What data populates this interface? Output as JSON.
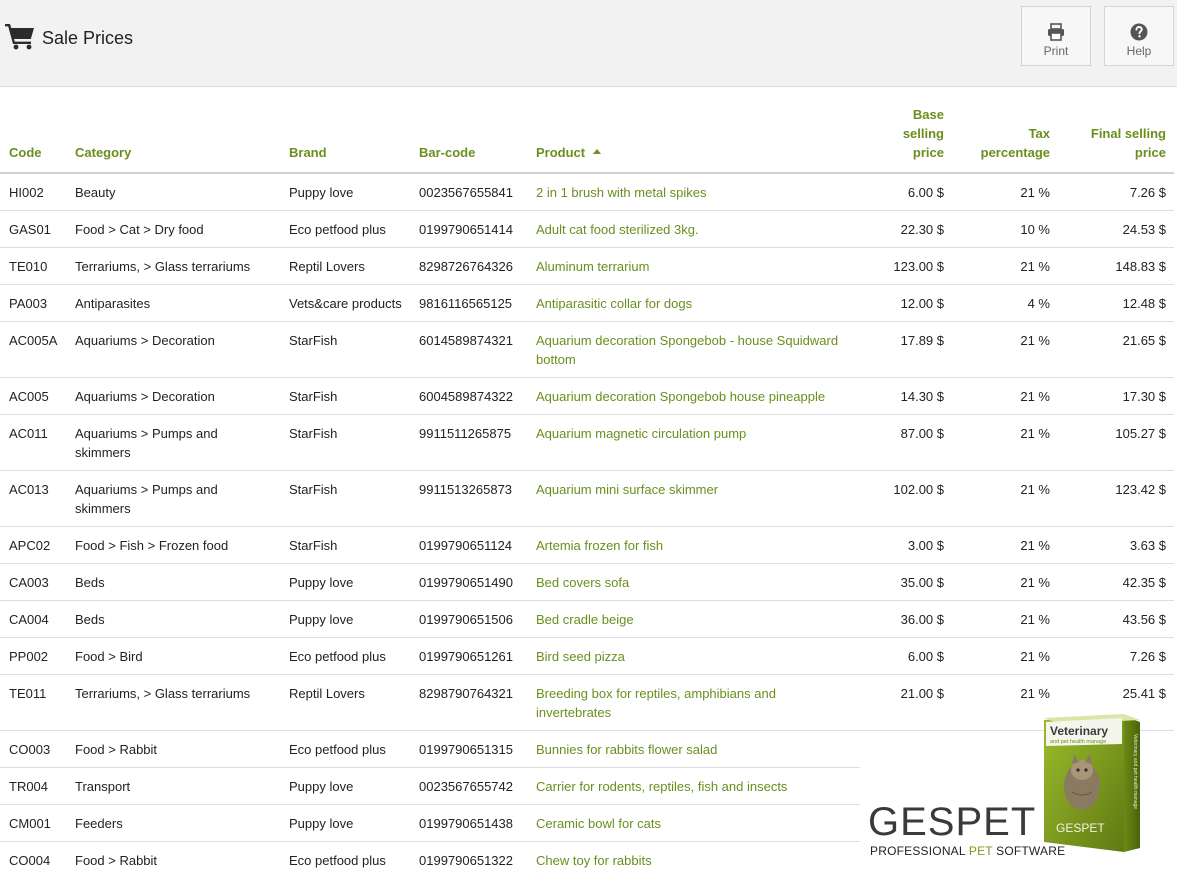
{
  "header": {
    "title": "Sale Prices",
    "print_label": "Print",
    "help_label": "Help"
  },
  "table": {
    "columns": {
      "code": "Code",
      "category": "Category",
      "brand": "Brand",
      "barcode": "Bar-code",
      "product": "Product",
      "base_line1": "Base selling",
      "base_line2": "price",
      "tax_line1": "Tax",
      "tax_line2": "percentage",
      "final_line1": "Final selling",
      "final_line2": "price"
    },
    "sort": {
      "column": "Product",
      "direction": "ascending"
    },
    "rows": [
      {
        "code": "HI002",
        "category": "Beauty",
        "brand": "Puppy love",
        "barcode": "0023567655841",
        "product": "2 in 1 brush with metal spikes",
        "base": "6.00 $",
        "tax": "21 %",
        "final": "7.26 $"
      },
      {
        "code": "GAS01",
        "category": "Food > Cat > Dry food",
        "brand": "Eco petfood plus",
        "barcode": "0199790651414",
        "product": "Adult cat food sterilized 3kg.",
        "base": "22.30 $",
        "tax": "10 %",
        "final": "24.53 $"
      },
      {
        "code": "TE010",
        "category": "Terrariums, > Glass terrariums",
        "brand": "Reptil Lovers",
        "barcode": "8298726764326",
        "product": "Aluminum terrarium",
        "base": "123.00 $",
        "tax": "21 %",
        "final": "148.83 $"
      },
      {
        "code": "PA003",
        "category": "Antiparasites",
        "brand": "Vets&care products",
        "barcode": "9816116565125",
        "product": "Antiparasitic collar for dogs",
        "base": "12.00 $",
        "tax": "4 %",
        "final": "12.48 $"
      },
      {
        "code": "AC005A",
        "category": "Aquariums > Decoration",
        "brand": "StarFish",
        "barcode": "6014589874321",
        "product": "Aquarium decoration Spongebob - house Squidward bottom",
        "base": "17.89 $",
        "tax": "21 %",
        "final": "21.65 $"
      },
      {
        "code": "AC005",
        "category": "Aquariums > Decoration",
        "brand": "StarFish",
        "barcode": "6004589874322",
        "product": "Aquarium decoration Spongebob house pineapple",
        "base": "14.30 $",
        "tax": "21 %",
        "final": "17.30 $"
      },
      {
        "code": "AC011",
        "category": "Aquariums > Pumps and skimmers",
        "brand": "StarFish",
        "barcode": "9911511265875",
        "product": "Aquarium magnetic circulation pump",
        "base": "87.00 $",
        "tax": "21 %",
        "final": "105.27 $"
      },
      {
        "code": "AC013",
        "category": "Aquariums > Pumps and skimmers",
        "brand": "StarFish",
        "barcode": "9911513265873",
        "product": "Aquarium mini surface skimmer",
        "base": "102.00 $",
        "tax": "21 %",
        "final": "123.42 $"
      },
      {
        "code": "APC02",
        "category": "Food > Fish > Frozen food",
        "brand": "StarFish",
        "barcode": "0199790651124",
        "product": "Artemia frozen for fish",
        "base": "3.00 $",
        "tax": "21 %",
        "final": "3.63 $"
      },
      {
        "code": "CA003",
        "category": "Beds",
        "brand": "Puppy love",
        "barcode": "0199790651490",
        "product": "Bed covers sofa",
        "base": "35.00 $",
        "tax": "21 %",
        "final": "42.35 $"
      },
      {
        "code": "CA004",
        "category": "Beds",
        "brand": "Puppy love",
        "barcode": "0199790651506",
        "product": "Bed cradle beige",
        "base": "36.00 $",
        "tax": "21 %",
        "final": "43.56 $"
      },
      {
        "code": "PP002",
        "category": "Food > Bird",
        "brand": "Eco petfood plus",
        "barcode": "0199790651261",
        "product": "Bird seed pizza",
        "base": "6.00 $",
        "tax": "21 %",
        "final": "7.26 $"
      },
      {
        "code": "TE011",
        "category": "Terrariums, > Glass terrariums",
        "brand": "Reptil Lovers",
        "barcode": "8298790764321",
        "product": "Breeding box for reptiles, amphibians and invertebrates",
        "base": "21.00 $",
        "tax": "21 %",
        "final": "25.41 $"
      },
      {
        "code": "CO003",
        "category": "Food > Rabbit",
        "brand": "Eco petfood plus",
        "barcode": "0199790651315",
        "product": "Bunnies for rabbits flower salad",
        "base": "",
        "tax": "",
        "final": ""
      },
      {
        "code": "TR004",
        "category": "Transport",
        "brand": "Puppy love",
        "barcode": "0023567655742",
        "product": "Carrier for rodents, reptiles, fish and insects",
        "base": "",
        "tax": "",
        "final": ""
      },
      {
        "code": "CM001",
        "category": "Feeders",
        "brand": "Puppy love",
        "barcode": "0199790651438",
        "product": "Ceramic bowl for cats",
        "base": "",
        "tax": "",
        "final": ""
      },
      {
        "code": "CO004",
        "category": "Food > Rabbit",
        "brand": "Eco petfood plus",
        "barcode": "0199790651322",
        "product": "Chew toy for rabbits",
        "base": "",
        "tax": "",
        "final": ""
      }
    ]
  },
  "promo": {
    "brand_ges": "GES",
    "brand_pet": "PET",
    "tagline_a": "PROFESSIONAL ",
    "tagline_b": "PET",
    "tagline_c": " SOFTWARE",
    "box_title": "Veterinary",
    "box_subtitle": "and pet health manage",
    "box_logo": "GESPET",
    "box_side": "Veterinary and pet health manage"
  },
  "colors": {
    "accent": "#6a8f1e",
    "topbar": "#f2f2f2",
    "border": "#dedede"
  },
  "icons": {
    "title": "shopping-cart-icon",
    "print": "printer-icon",
    "help": "question-circle-icon"
  }
}
